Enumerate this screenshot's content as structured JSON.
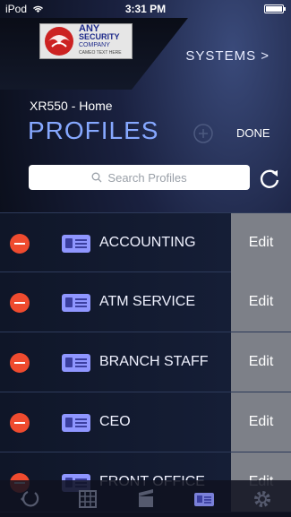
{
  "status_bar": {
    "carrier": "iPod",
    "time": "3:31 PM",
    "battery_level": 1.0
  },
  "header": {
    "logo": {
      "line1": "ANY",
      "line2": "SECURITY",
      "line3": "COMPANY",
      "line4": "CAMEO TEXT HERE"
    },
    "systems_label": "SYSTEMS >"
  },
  "page": {
    "account": "XR550 - Home",
    "title": "PROFILES",
    "done_label": "DONE"
  },
  "search": {
    "placeholder": "Search Profiles"
  },
  "profiles": [
    {
      "name": "ACCOUNTING",
      "edit_label": "Edit"
    },
    {
      "name": "ATM SERVICE",
      "edit_label": "Edit"
    },
    {
      "name": "BRANCH STAFF",
      "edit_label": "Edit"
    },
    {
      "name": "CEO",
      "edit_label": "Edit"
    },
    {
      "name": "FRONT OFFICE",
      "edit_label": "Edit"
    }
  ],
  "colors": {
    "accent": "#86a8ff",
    "delete": "#ef4b2f",
    "edit_bg": "#7d8088"
  },
  "tabs": [
    {
      "icon": "arming-icon"
    },
    {
      "icon": "grid-icon"
    },
    {
      "icon": "film-icon"
    },
    {
      "icon": "user-card-icon"
    },
    {
      "icon": "gear-icon"
    }
  ]
}
